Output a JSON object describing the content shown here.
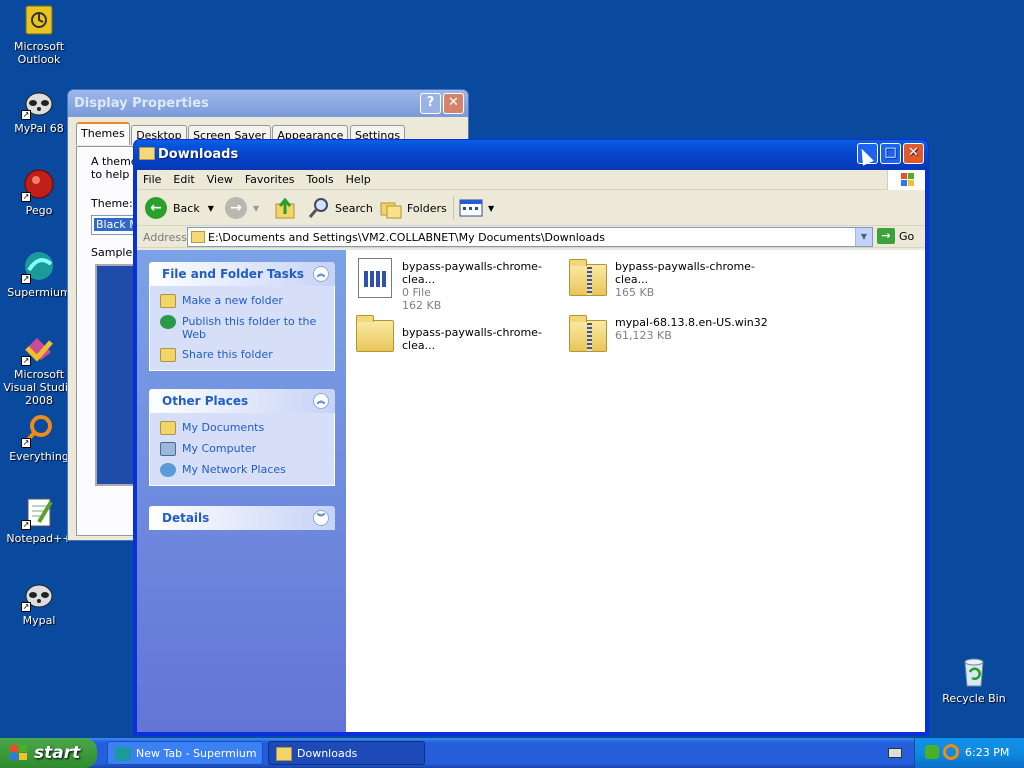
{
  "desktop": {
    "icons": [
      {
        "label": "Microsoft Outlook",
        "icon": "outlook-icon"
      },
      {
        "label": "MyPal 68",
        "icon": "raccoon-icon"
      },
      {
        "label": "Pego",
        "icon": "pego-icon"
      },
      {
        "label": "Supermium",
        "icon": "supermium-icon"
      },
      {
        "label": "Microsoft Visual Studio 2008",
        "icon": "visual-studio-icon"
      },
      {
        "label": "Everything",
        "icon": "search-icon"
      },
      {
        "label": "Notepad++",
        "icon": "notepad-plus-plus-icon"
      },
      {
        "label": "Mypal",
        "icon": "raccoon-icon"
      },
      {
        "label": "Recycle Bin",
        "icon": "recycle-bin-icon"
      }
    ]
  },
  "display_properties": {
    "title": "Display Properties",
    "tabs": [
      "Themes",
      "Desktop",
      "Screen Saver",
      "Appearance",
      "Settings"
    ],
    "intro_line1": "A theme",
    "intro_line2": "to help yo",
    "theme_label": "Theme:",
    "theme_value": "Black M",
    "sample_label": "Sample:"
  },
  "explorer": {
    "title": "Downloads",
    "menu": [
      "File",
      "Edit",
      "View",
      "Favorites",
      "Tools",
      "Help"
    ],
    "toolbar": {
      "back": "Back",
      "search": "Search",
      "folders": "Folders"
    },
    "address": {
      "label": "Address",
      "value": "E:\\Documents and Settings\\VM2.COLLABNET\\My Documents\\Downloads",
      "go": "Go"
    },
    "tasks": {
      "file_folder": {
        "title": "File and Folder Tasks",
        "items": [
          "Make a new folder",
          "Publish this folder to the Web",
          "Share this folder"
        ]
      },
      "other_places": {
        "title": "Other Places",
        "items": [
          "My Documents",
          "My Computer",
          "My Network Places"
        ]
      },
      "details": {
        "title": "Details"
      }
    },
    "files": [
      {
        "name": "bypass-paywalls-chrome-clea...",
        "type": "0 File",
        "size": "162 KB",
        "kind": "file"
      },
      {
        "name": "bypass-paywalls-chrome-clea...",
        "type": "",
        "size": "165 KB",
        "kind": "zip"
      },
      {
        "name": "bypass-paywalls-chrome-clea...",
        "type": "",
        "size": "",
        "kind": "folder"
      },
      {
        "name": "mypal-68.13.8.en-US.win32",
        "type": "",
        "size": "61,123 KB",
        "kind": "zip"
      }
    ]
  },
  "taskbar": {
    "start": "start",
    "tasks": [
      {
        "label": "New Tab - Supermium"
      },
      {
        "label": "Downloads"
      }
    ],
    "clock": "6:23 PM"
  },
  "colors": {
    "desktop": "#0a4a9e",
    "titlebar_active": "#0648d0",
    "task_link": "#215dc6",
    "start_green": "#3c9a3c"
  }
}
